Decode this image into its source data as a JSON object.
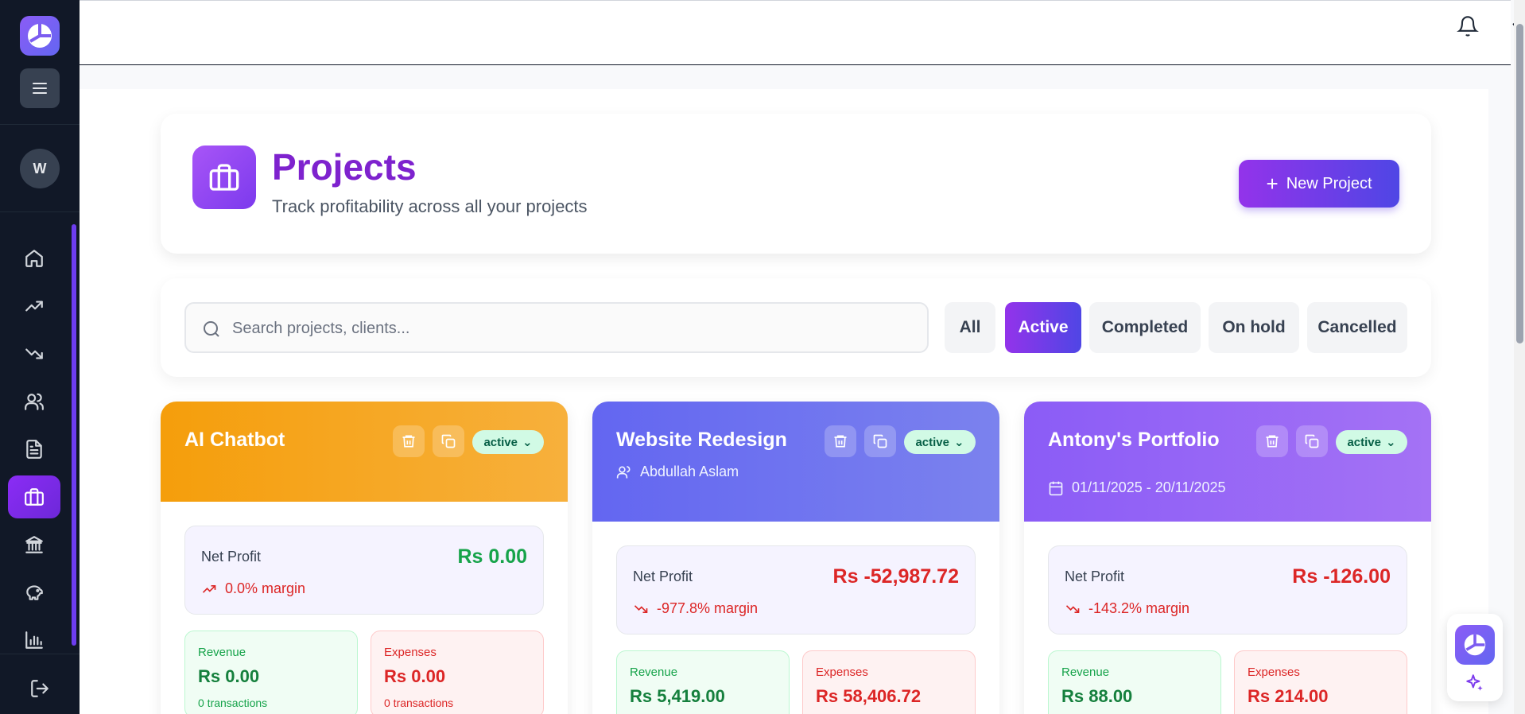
{
  "sidebar": {
    "avatar_initial": "W",
    "items": [
      {
        "name": "home",
        "icon": "home-icon"
      },
      {
        "name": "income",
        "icon": "trending-up-icon"
      },
      {
        "name": "expenses",
        "icon": "trending-down-icon"
      },
      {
        "name": "clients",
        "icon": "users-icon"
      },
      {
        "name": "documents",
        "icon": "file-text-icon"
      },
      {
        "name": "projects",
        "icon": "briefcase-icon",
        "active": true
      },
      {
        "name": "banking",
        "icon": "bank-icon"
      },
      {
        "name": "savings",
        "icon": "piggy-bank-icon"
      },
      {
        "name": "reports",
        "icon": "bar-chart-icon"
      }
    ]
  },
  "header": {
    "title": "Projects",
    "subtitle": "Track profitability across all your projects",
    "new_project_label": "New Project"
  },
  "search": {
    "placeholder": "Search projects, clients...",
    "value": ""
  },
  "filters": [
    {
      "label": "All",
      "active": false
    },
    {
      "label": "Active",
      "active": true
    },
    {
      "label": "Completed",
      "active": false
    },
    {
      "label": "On hold",
      "active": false
    },
    {
      "label": "Cancelled",
      "active": false
    }
  ],
  "projects": [
    {
      "title": "AI Chatbot",
      "status": "active",
      "client": "",
      "dates": "",
      "net_profit_label": "Net Profit",
      "net_profit": "Rs 0.00",
      "margin": "0.0% margin",
      "revenue_label": "Revenue",
      "revenue": "Rs 0.00",
      "revenue_tx": "0 transactions",
      "expenses_label": "Expenses",
      "expenses": "Rs 0.00",
      "expenses_tx": "0 transactions",
      "header_color": "#f5a623",
      "profit_color": "#16a34a"
    },
    {
      "title": "Website Redesign",
      "status": "active",
      "client": "Abdullah Aslam",
      "dates": "",
      "net_profit_label": "Net Profit",
      "net_profit": "Rs -52,987.72",
      "margin": "-977.8% margin",
      "revenue_label": "Revenue",
      "revenue": "Rs 5,419.00",
      "expenses_label": "Expenses",
      "expenses": "Rs 58,406.72",
      "header_color": "#6366f1",
      "profit_color": "#dc2626"
    },
    {
      "title": "Antony's Portfolio",
      "status": "active",
      "client": "",
      "dates": "01/11/2025 - 20/11/2025",
      "net_profit_label": "Net Profit",
      "net_profit": "Rs -126.00",
      "margin": "-143.2% margin",
      "revenue_label": "Revenue",
      "revenue": "Rs 88.00",
      "expenses_label": "Expenses",
      "expenses": "Rs 214.00",
      "header_color": "#8b5cf6",
      "profit_color": "#dc2626"
    }
  ],
  "colors": {
    "accent": "#9333ea",
    "sidebar_bg": "#111827"
  }
}
